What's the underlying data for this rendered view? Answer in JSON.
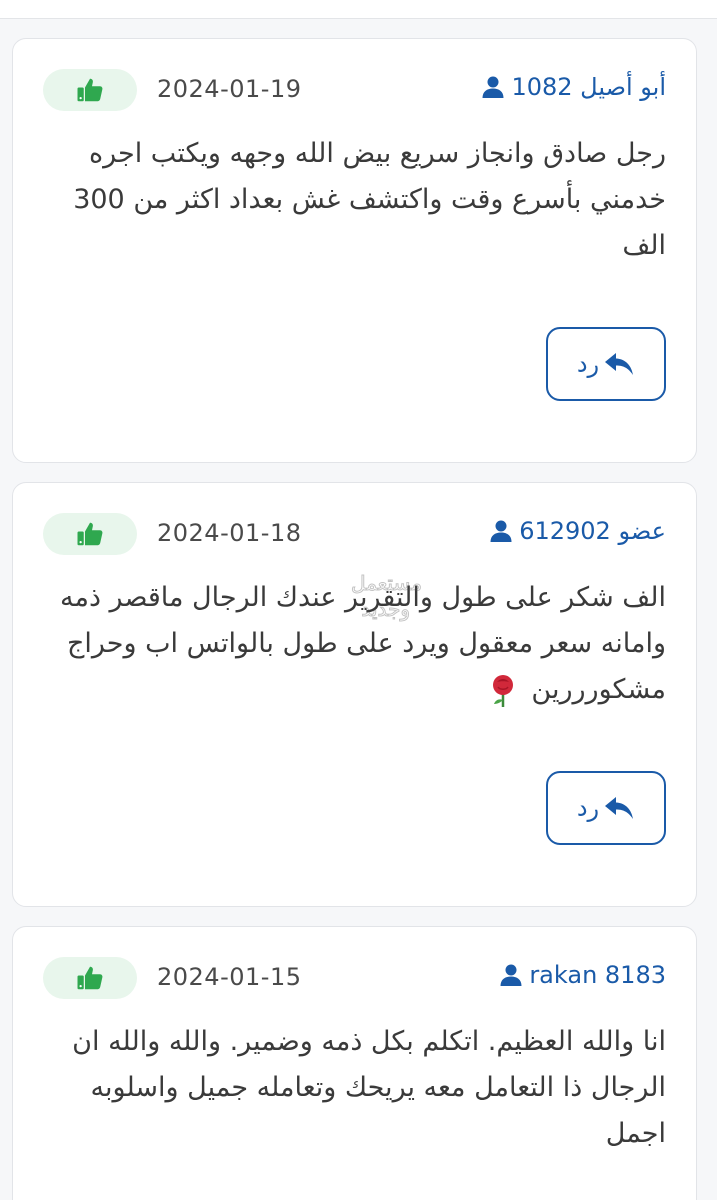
{
  "colors": {
    "accent": "#1a5aa8",
    "like_bg": "#e8f6ec",
    "like_icon": "#2fa84f",
    "text": "#3a3a3a",
    "rose": "#d1283a"
  },
  "reviews": [
    {
      "author": "أبو أصيل 1082",
      "date": "2024-01-19",
      "text": "رجل صادق وانجاز سريع بيض الله وجهه ويكتب اجره خدمني بأسرع وقت واكتشف غش بعداد اكثر من 300 الف",
      "reply_label": "رد",
      "icons": {
        "user": "user-icon",
        "like": "thumbs-up-icon",
        "reply": "reply-arrow-icon"
      }
    },
    {
      "author": "عضو 612902",
      "date": "2024-01-18",
      "text": "الف شكر على طول والتقرير عندك الرجال ماقصر ذمه وامانه سعر معقول ويرد على طول بالواتس اب وحراج مشكورررين",
      "reply_label": "رد",
      "icons": {
        "user": "user-icon",
        "like": "thumbs-up-icon",
        "reply": "reply-arrow-icon",
        "emoji": "rose-icon"
      }
    },
    {
      "author": "rakan 8183",
      "date": "2024-01-15",
      "text": "انا والله العظيم. اتكلم بكل ذمه وضمير. والله والله ان الرجال ذا التعامل معه يريحك وتعامله جميل واسلوبه اجمل",
      "icons": {
        "user": "user-icon",
        "like": "thumbs-up-icon"
      }
    }
  ],
  "watermark": {
    "text": "مستعمل وجديد",
    "icon": "watermark-logo"
  }
}
